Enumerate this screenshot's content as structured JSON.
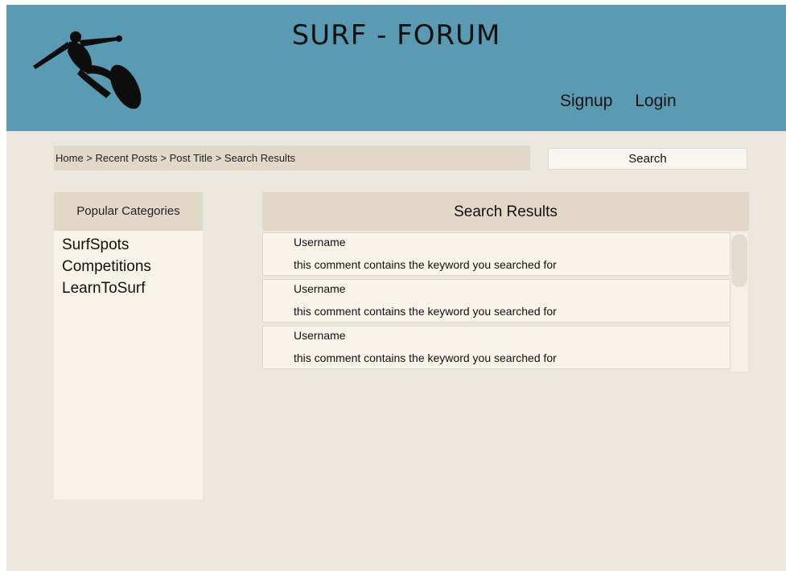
{
  "header": {
    "title": "SURF - FORUM",
    "logo_icon": "surfer-icon",
    "nav": {
      "signup": "Signup",
      "login": "Login"
    },
    "color": "#5a9bb3"
  },
  "breadcrumb": {
    "text": "Home > Recent Posts > Post Title > Search Results"
  },
  "search": {
    "label": "Search"
  },
  "sidebar": {
    "title": "Popular Categories",
    "categories": [
      "SurfSpots",
      "Competitions",
      "LearnToSurf"
    ]
  },
  "results": {
    "title": "Search Results",
    "items": [
      {
        "username": "Username",
        "comment": "this comment contains the keyword you searched for"
      },
      {
        "username": "Username",
        "comment": "this comment contains the keyword you searched for"
      },
      {
        "username": "Username",
        "comment": "this comment contains the keyword you searched for"
      }
    ]
  }
}
